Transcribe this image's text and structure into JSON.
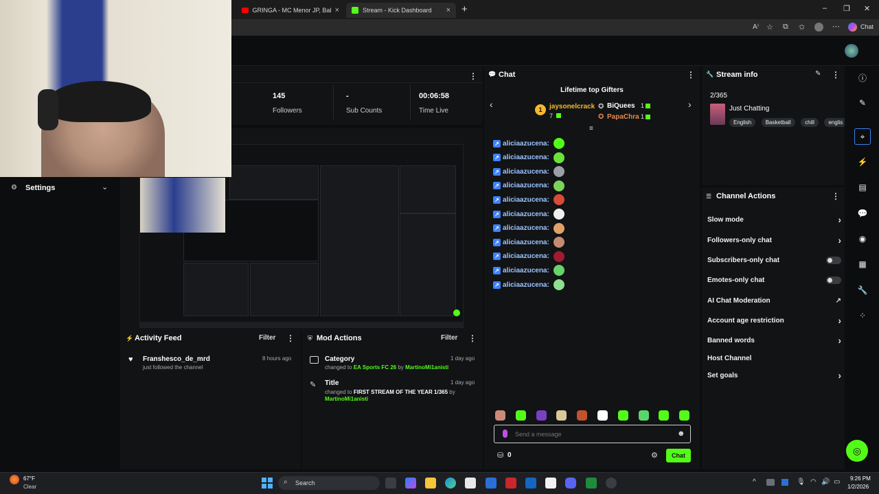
{
  "browser": {
    "tabs": [
      {
        "title": "GRINGA - MC Menor JP, Baby Gan",
        "close": "×"
      },
      {
        "title": "Stream - Kick Dashboard",
        "close": "×"
      }
    ],
    "new_tab": "+",
    "copilot_label": "Chat",
    "window_controls": [
      "–",
      "❐",
      "✕"
    ]
  },
  "stats": {
    "followers_value": "145",
    "followers_label": "Followers",
    "subs_value": "-",
    "subs_label": "Sub Counts",
    "time_value": "00:06:58",
    "time_label": "Time Live"
  },
  "settings": {
    "label": "Settings"
  },
  "activity_feed": {
    "title": "Activity Feed",
    "filter": "Filter",
    "items": [
      {
        "user": "Franshesco_de_mrd",
        "action": "just followed the channel",
        "time": "8 hours ago"
      }
    ]
  },
  "mod_actions": {
    "title": "Mod Actions",
    "filter": "Filter",
    "items": [
      {
        "type": "Category",
        "changed": "changed to",
        "value": "EA Sports FC 26",
        "by": "by",
        "user": "MartinoMi1anisti",
        "time": "1 day ago"
      },
      {
        "type": "Title",
        "changed": "changed to",
        "value": "FIRST STREAM OF THE YEAR 1/365",
        "by": "by",
        "user": "MartinoMi1anisti",
        "time": "1 day ago"
      }
    ]
  },
  "chat": {
    "title": "Chat",
    "gifters_title": "Lifetime top Gifters",
    "gifters": [
      {
        "name": "jaysonelcrack",
        "count": "7",
        "rank": "1"
      },
      {
        "name": "BiQuees",
        "count": "1"
      },
      {
        "name": "PapaChra",
        "count": "1"
      }
    ],
    "messages": [
      {
        "user": "aliciaazucena:"
      },
      {
        "user": "aliciaazucena:"
      },
      {
        "user": "aliciaazucena:"
      },
      {
        "user": "aliciaazucena:"
      },
      {
        "user": "aliciaazucena:"
      },
      {
        "user": "aliciaazucena:"
      },
      {
        "user": "aliciaazucena:"
      },
      {
        "user": "aliciaazucena:"
      },
      {
        "user": "aliciaazucena:"
      },
      {
        "user": "aliciaazucena:"
      },
      {
        "user": "aliciaazucena:"
      }
    ],
    "input_placeholder": "Send a message",
    "points": "0",
    "send_label": "Chat"
  },
  "stream_info": {
    "title": "Stream info",
    "stream_title": "2/365",
    "category": "Just Chatting",
    "tags": [
      "English",
      "Basketball",
      "chill",
      "englis"
    ]
  },
  "channel_actions": {
    "title": "Channel Actions",
    "items": [
      {
        "label": "Slow mode",
        "control": "chevron"
      },
      {
        "label": "Followers-only chat",
        "control": "chevron"
      },
      {
        "label": "Subscribers-only chat",
        "control": "toggle"
      },
      {
        "label": "Emotes-only chat",
        "control": "toggle"
      },
      {
        "label": "AI Chat Moderation",
        "control": "external"
      },
      {
        "label": "Account age restriction",
        "control": "chevron"
      },
      {
        "label": "Banned words",
        "control": "chevron"
      },
      {
        "label": "Host Channel",
        "control": "none"
      },
      {
        "label": "Set goals",
        "control": "chevron"
      }
    ]
  },
  "taskbar": {
    "weather_temp": "67°F",
    "weather_desc": "Clear",
    "search_label": "Search",
    "time": "9:26 PM",
    "date": "1/2/2026"
  },
  "colors": {
    "accent": "#53fc18",
    "bg": "#0b0d0f",
    "panel": "#111315",
    "link": "#53fc18"
  }
}
